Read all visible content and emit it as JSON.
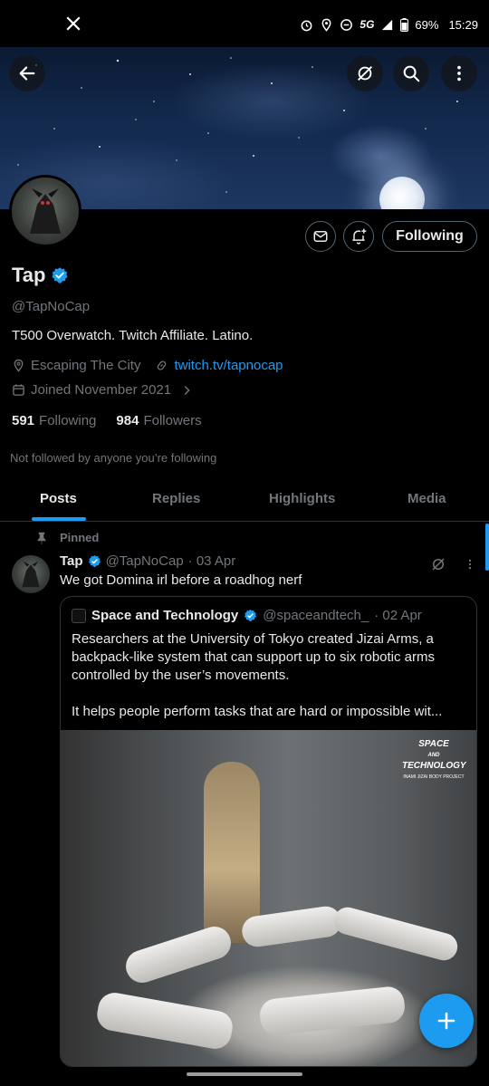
{
  "status_bar": {
    "network": "5G",
    "battery": "69%",
    "time": "15:29"
  },
  "profile": {
    "name": "Tap",
    "handle": "@TapNoCap",
    "bio": "T500 Overwatch. Twitch Affiliate. Latino.",
    "location": "Escaping The City",
    "website": "twitch.tv/tapnocap",
    "joined": "Joined November 2021",
    "following_count": "591",
    "following_label": "Following",
    "followers_count": "984",
    "followers_label": "Followers",
    "not_followed_text": "Not followed by anyone you’re following",
    "follow_button_label": "Following"
  },
  "tabs": [
    {
      "label": "Posts",
      "active": true
    },
    {
      "label": "Replies",
      "active": false
    },
    {
      "label": "Highlights",
      "active": false
    },
    {
      "label": "Media",
      "active": false
    }
  ],
  "pinned_post": {
    "pinned_label": "Pinned",
    "author": "Tap",
    "handle": "@TapNoCap",
    "date": "· 03 Apr",
    "text": "We got Domina irl before a roadhog nerf",
    "quote": {
      "author": "Space and Technology",
      "handle": "@spaceandtech_",
      "date": "· 02 Apr",
      "text1": "Researchers at the University of Tokyo created Jizai Arms, a backpack-like system that can support up to six robotic arms controlled by the user’s movements.",
      "text2": "It helps people perform tasks that are hard or impossible wit...",
      "media_brand": "SPACE",
      "media_brand_and": "AND",
      "media_brand_2": "TECHNOLOGY",
      "media_brand_sub": "INAMI JIZAI BODY PROJECT"
    }
  },
  "colors": {
    "accent": "#1d9bf0",
    "background": "#000000",
    "text_primary": "#e7e9ea",
    "text_secondary": "#71767b",
    "border": "#2f3336"
  },
  "icons": {
    "back": "arrow-left-icon",
    "grok": "grok-icon",
    "search": "search-icon",
    "more": "more-vertical-icon",
    "message": "mail-icon",
    "notify": "bell-plus-icon",
    "verified": "verified-badge-icon",
    "location": "location-pin-icon",
    "link": "link-icon",
    "calendar": "calendar-icon",
    "pin": "pin-icon",
    "compose": "plus-icon"
  }
}
